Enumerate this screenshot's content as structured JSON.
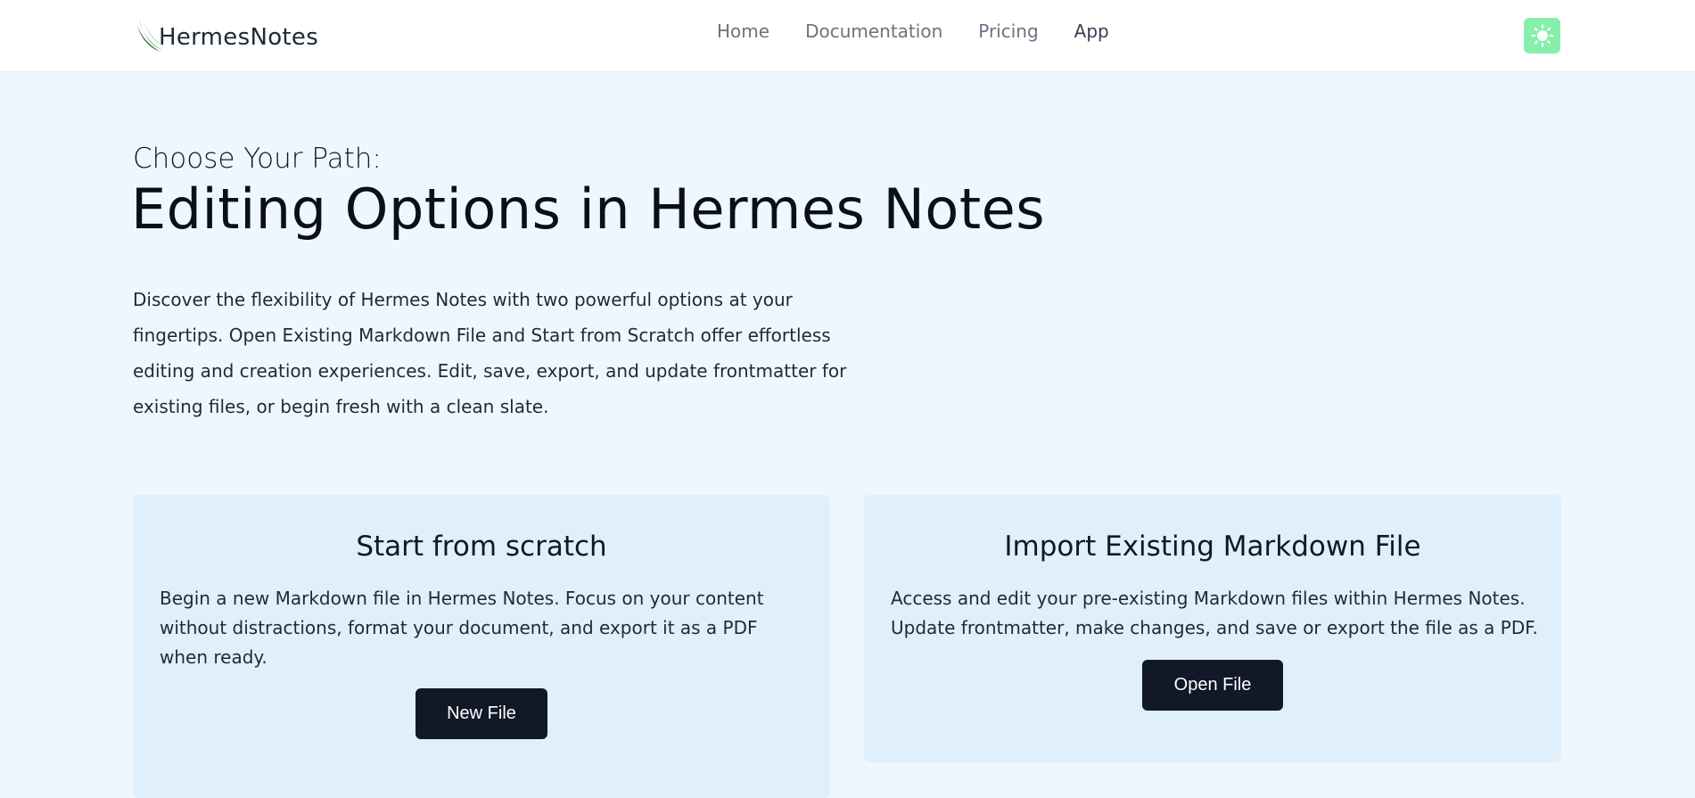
{
  "brand": {
    "name": "HermesNotes"
  },
  "nav": {
    "links": [
      "Home",
      "Documentation",
      "Pricing",
      "App"
    ]
  },
  "theme_toggle": {
    "icon": "sun-icon",
    "color": "#86efac"
  },
  "hero": {
    "kicker": "Choose Your Path:",
    "headline": "Editing Options in Hermes Notes",
    "intro": "Discover the flexibility of Hermes Notes with two powerful options at your fingertips. Open Existing Markdown File and Start from Scratch offer effortless editing and creation experiences. Edit, save, export, and update frontmatter for existing files, or begin fresh with a clean slate."
  },
  "cards": [
    {
      "title": "Start from scratch",
      "text": "Begin a new Markdown file in Hermes Notes. Focus on your content without distractions, format your document, and export it as a PDF when ready.",
      "button": "New File"
    },
    {
      "title": "Import Existing Markdown File",
      "text": "Access and edit your pre-existing Markdown files within Hermes Notes. Update frontmatter, make changes, and save or export the file as a PDF.",
      "button": "Open File"
    }
  ],
  "colors": {
    "page_bg": "#eff7fe",
    "card_bg": "#dff0fc",
    "button_bg": "#111827",
    "logo_green": "#3f8f3f"
  }
}
